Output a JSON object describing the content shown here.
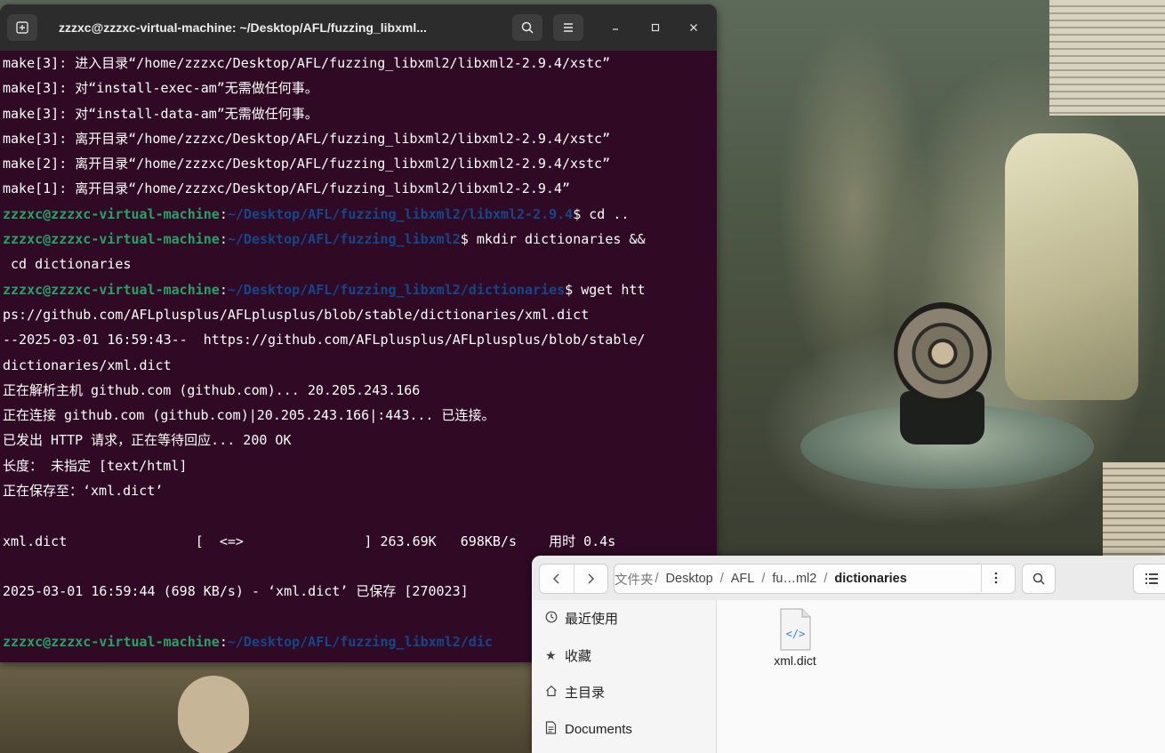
{
  "terminal": {
    "title": "zzzxc@zzzxc-virtual-machine: ~/Desktop/AFL/fuzzing_libxml...",
    "icons": {
      "new_tab": "new-tab-icon",
      "search": "search-icon",
      "menu": "hamburger-menu-icon",
      "minimize": "minimize-icon",
      "maximize": "maximize-icon",
      "close": "close-icon"
    },
    "lines": [
      "make[3]: 进入目录“/home/zzzxc/Desktop/AFL/fuzzing_libxml2/libxml2-2.9.4/xstc”",
      "make[3]: 对“install-exec-am”无需做任何事。",
      "make[3]: 对“install-data-am”无需做任何事。",
      "make[3]: 离开目录“/home/zzzxc/Desktop/AFL/fuzzing_libxml2/libxml2-2.9.4/xstc”",
      "make[2]: 离开目录“/home/zzzxc/Desktop/AFL/fuzzing_libxml2/libxml2-2.9.4/xstc”",
      "make[1]: 离开目录“/home/zzzxc/Desktop/AFL/fuzzing_libxml2/libxml2-2.9.4”"
    ],
    "prompt_user": "zzzxc@zzzxc-virtual-machine",
    "prompt_sep": ":",
    "prompt1_path": "~/Desktop/AFL/fuzzing_libxml2/libxml2-2.9.4",
    "prompt1_cmd": "$ cd ..",
    "prompt2_path": "~/Desktop/AFL/fuzzing_libxml2",
    "prompt2_cmd": "$ mkdir dictionaries &&",
    "prompt2_cont": " cd dictionaries",
    "prompt3_path": "~/Desktop/AFL/fuzzing_libxml2/dictionaries",
    "prompt3_cmd": "$ wget htt",
    "output_lines": [
      "ps://github.com/AFLplusplus/AFLplusplus/blob/stable/dictionaries/xml.dict",
      "--2025-03-01 16:59:43--  https://github.com/AFLplusplus/AFLplusplus/blob/stable/",
      "dictionaries/xml.dict",
      "正在解析主机 github.com (github.com)... 20.205.243.166",
      "正在连接 github.com (github.com)|20.205.243.166|:443... 已连接。",
      "已发出 HTTP 请求，正在等待回应... 200 OK",
      "长度： 未指定 [text/html]",
      "正在保存至：‘xml.dict’",
      "",
      "xml.dict                [  <=>               ] 263.69K   698KB/s    用时 0.4s",
      "",
      "2025-03-01 16:59:44 (698 KB/s) - ‘xml.dict’ 已保存 [270023]",
      ""
    ],
    "prompt4_path": "~/Desktop/AFL/fuzzing_libxml2/dic"
  },
  "files": {
    "icons": {
      "back": "chevron-left-icon",
      "forward": "chevron-right-icon",
      "path_menu": "more-vertical-icon",
      "search": "search-icon",
      "view": "list-view-icon"
    },
    "breadcrumb": {
      "first_partial": "文件夹",
      "items": [
        "Desktop",
        "AFL",
        "fu…ml2"
      ],
      "current": "dictionaries",
      "separator": "/"
    },
    "sidebar": [
      {
        "label": "最近使用",
        "icon": "clock-icon"
      },
      {
        "label": "收藏",
        "icon": "star-icon"
      },
      {
        "label": "主目录",
        "icon": "home-icon"
      },
      {
        "label": "Documents",
        "icon": "document-icon"
      }
    ],
    "content": {
      "items": [
        {
          "name": "xml.dict",
          "icon": "code-file-icon"
        }
      ]
    }
  },
  "colors": {
    "terminal_bg": "#300a24",
    "prompt_user": "#26a269",
    "prompt_path": "#12488b",
    "titlebar": "#2c2c2c"
  }
}
